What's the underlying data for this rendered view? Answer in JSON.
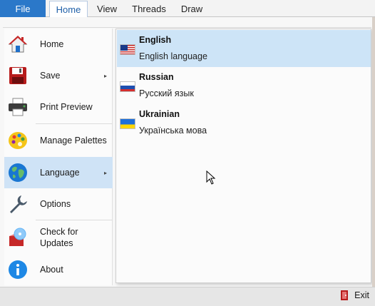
{
  "ribbon": {
    "file_label": "File",
    "tabs": [
      {
        "label": "Home",
        "active": true
      },
      {
        "label": "View",
        "active": false
      },
      {
        "label": "Threads",
        "active": false
      },
      {
        "label": "Draw",
        "active": false
      }
    ]
  },
  "menu": {
    "items": [
      {
        "label": "Home",
        "icon": "house-icon"
      },
      {
        "label": "Save",
        "icon": "floppy-disk-icon",
        "has_submenu": true
      },
      {
        "label": "Print Preview",
        "icon": "printer-icon"
      },
      {
        "label": "Manage Palettes",
        "icon": "palette-icon"
      },
      {
        "label": "Language",
        "icon": "globe-icon",
        "has_submenu": true,
        "selected": true
      },
      {
        "label": "Options",
        "icon": "wrench-icon"
      },
      {
        "label": "Check for\nUpdates",
        "icon": "update-disc-icon"
      },
      {
        "label": "About",
        "icon": "info-icon"
      }
    ],
    "submenu_arrow": "▸"
  },
  "languages": [
    {
      "name": "English",
      "native": "English language",
      "flag": "us-flag-icon",
      "selected": true
    },
    {
      "name": "Russian",
      "native": "Русский язык",
      "flag": "ru-flag-icon",
      "selected": false
    },
    {
      "name": "Ukrainian",
      "native": "Українська мова",
      "flag": "ua-flag-icon",
      "selected": false
    }
  ],
  "statusbar": {
    "exit_label": "Exit"
  },
  "colors": {
    "accent": "#2b78c9",
    "selected_bg": "#cfe3f6"
  }
}
